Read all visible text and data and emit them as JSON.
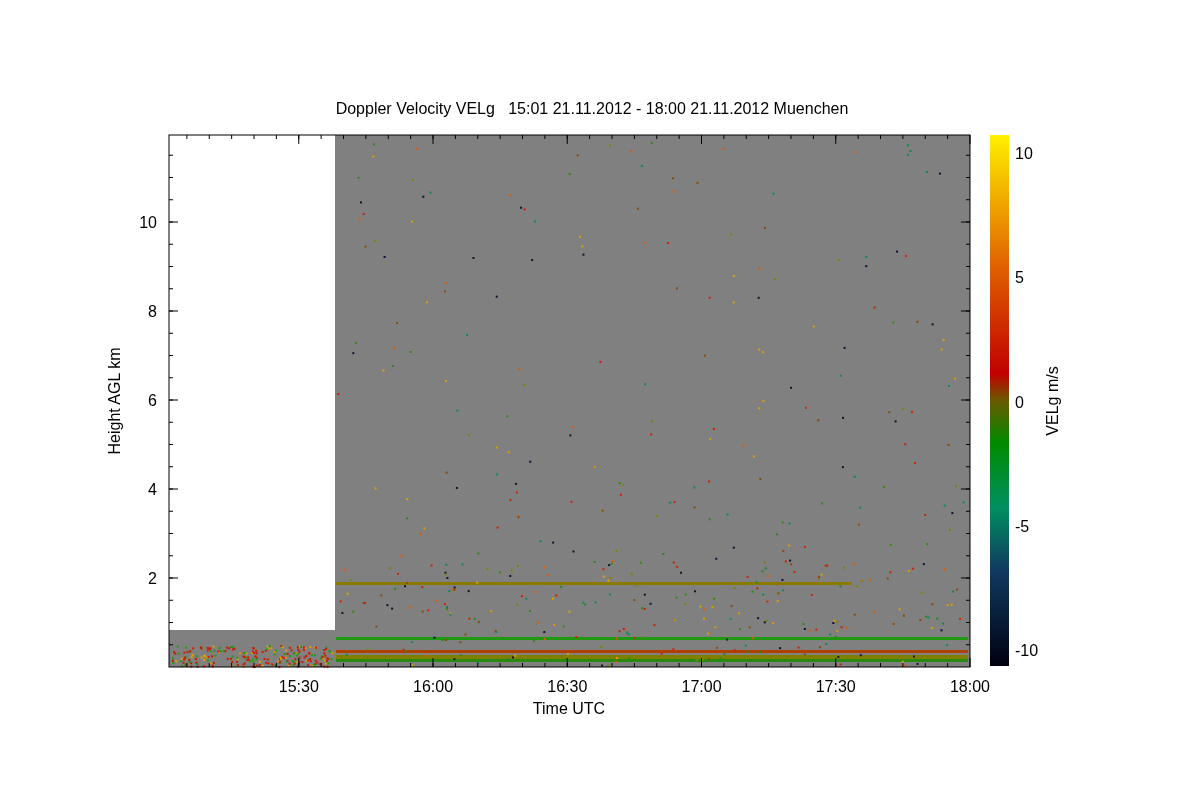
{
  "title": "Doppler Velocity VELg   15:01 21.11.2012 - 18:00 21.11.2012 Muenchen",
  "x_axis": {
    "label": "Time UTC",
    "ticks": [
      "15:30",
      "16:00",
      "16:30",
      "17:00",
      "17:30",
      "18:00"
    ]
  },
  "y_axis": {
    "label": "Height AGL km",
    "ticks": [
      "10",
      "8",
      "6",
      "4",
      "2"
    ]
  },
  "colorbar": {
    "label": "VELg m/s",
    "ticks": [
      "10",
      "5",
      "0",
      "-5",
      "-10"
    ]
  }
}
